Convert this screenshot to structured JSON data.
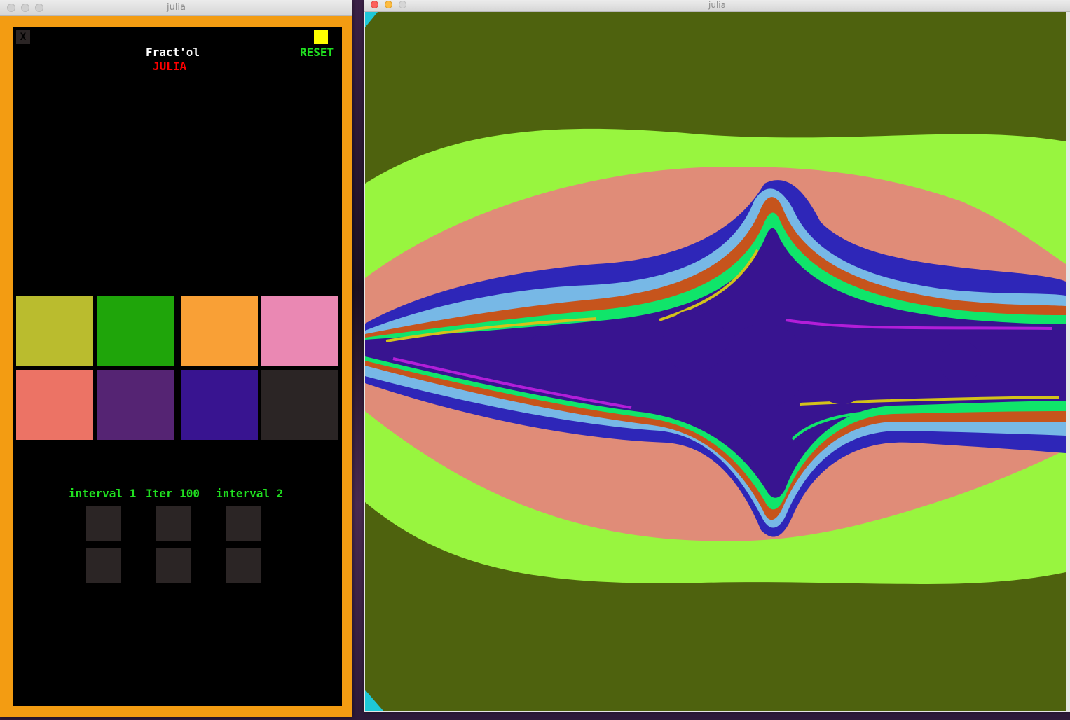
{
  "control_window": {
    "title": "julia",
    "close_label": "X",
    "app_title": "Fract'ol",
    "fractal_name": "JULIA",
    "reset_label": "RESET",
    "palette_swatches": [
      {
        "color": "#babc2e"
      },
      {
        "color": "#1fa50a"
      },
      {
        "color": "#f9a036"
      },
      {
        "color": "#ea88b3"
      },
      {
        "color": "#ec7365"
      },
      {
        "color": "#552473"
      },
      {
        "color": "#381490"
      },
      {
        "color": "#2b2525"
      }
    ],
    "controls": {
      "interval1_label": "interval 1",
      "iter_label": "Iter 100",
      "interval2_label": "interval 2"
    }
  },
  "fractal_window": {
    "title": "julia"
  },
  "colors": {
    "panel_border": "#f39c12",
    "canvas_bg": "#000000",
    "title_text": "#ffffff",
    "fractal_name_text": "#ff0000",
    "reset_text": "#20e020",
    "controls_text": "#20e020",
    "reset_square": "#ffff00",
    "button_fill": "#2b2525",
    "fractal_bands": [
      "#4e620e",
      "#98f53f",
      "#e08c78",
      "#2e26b8",
      "#77b8e6",
      "#c6541c",
      "#10e56a",
      "#381490"
    ]
  }
}
